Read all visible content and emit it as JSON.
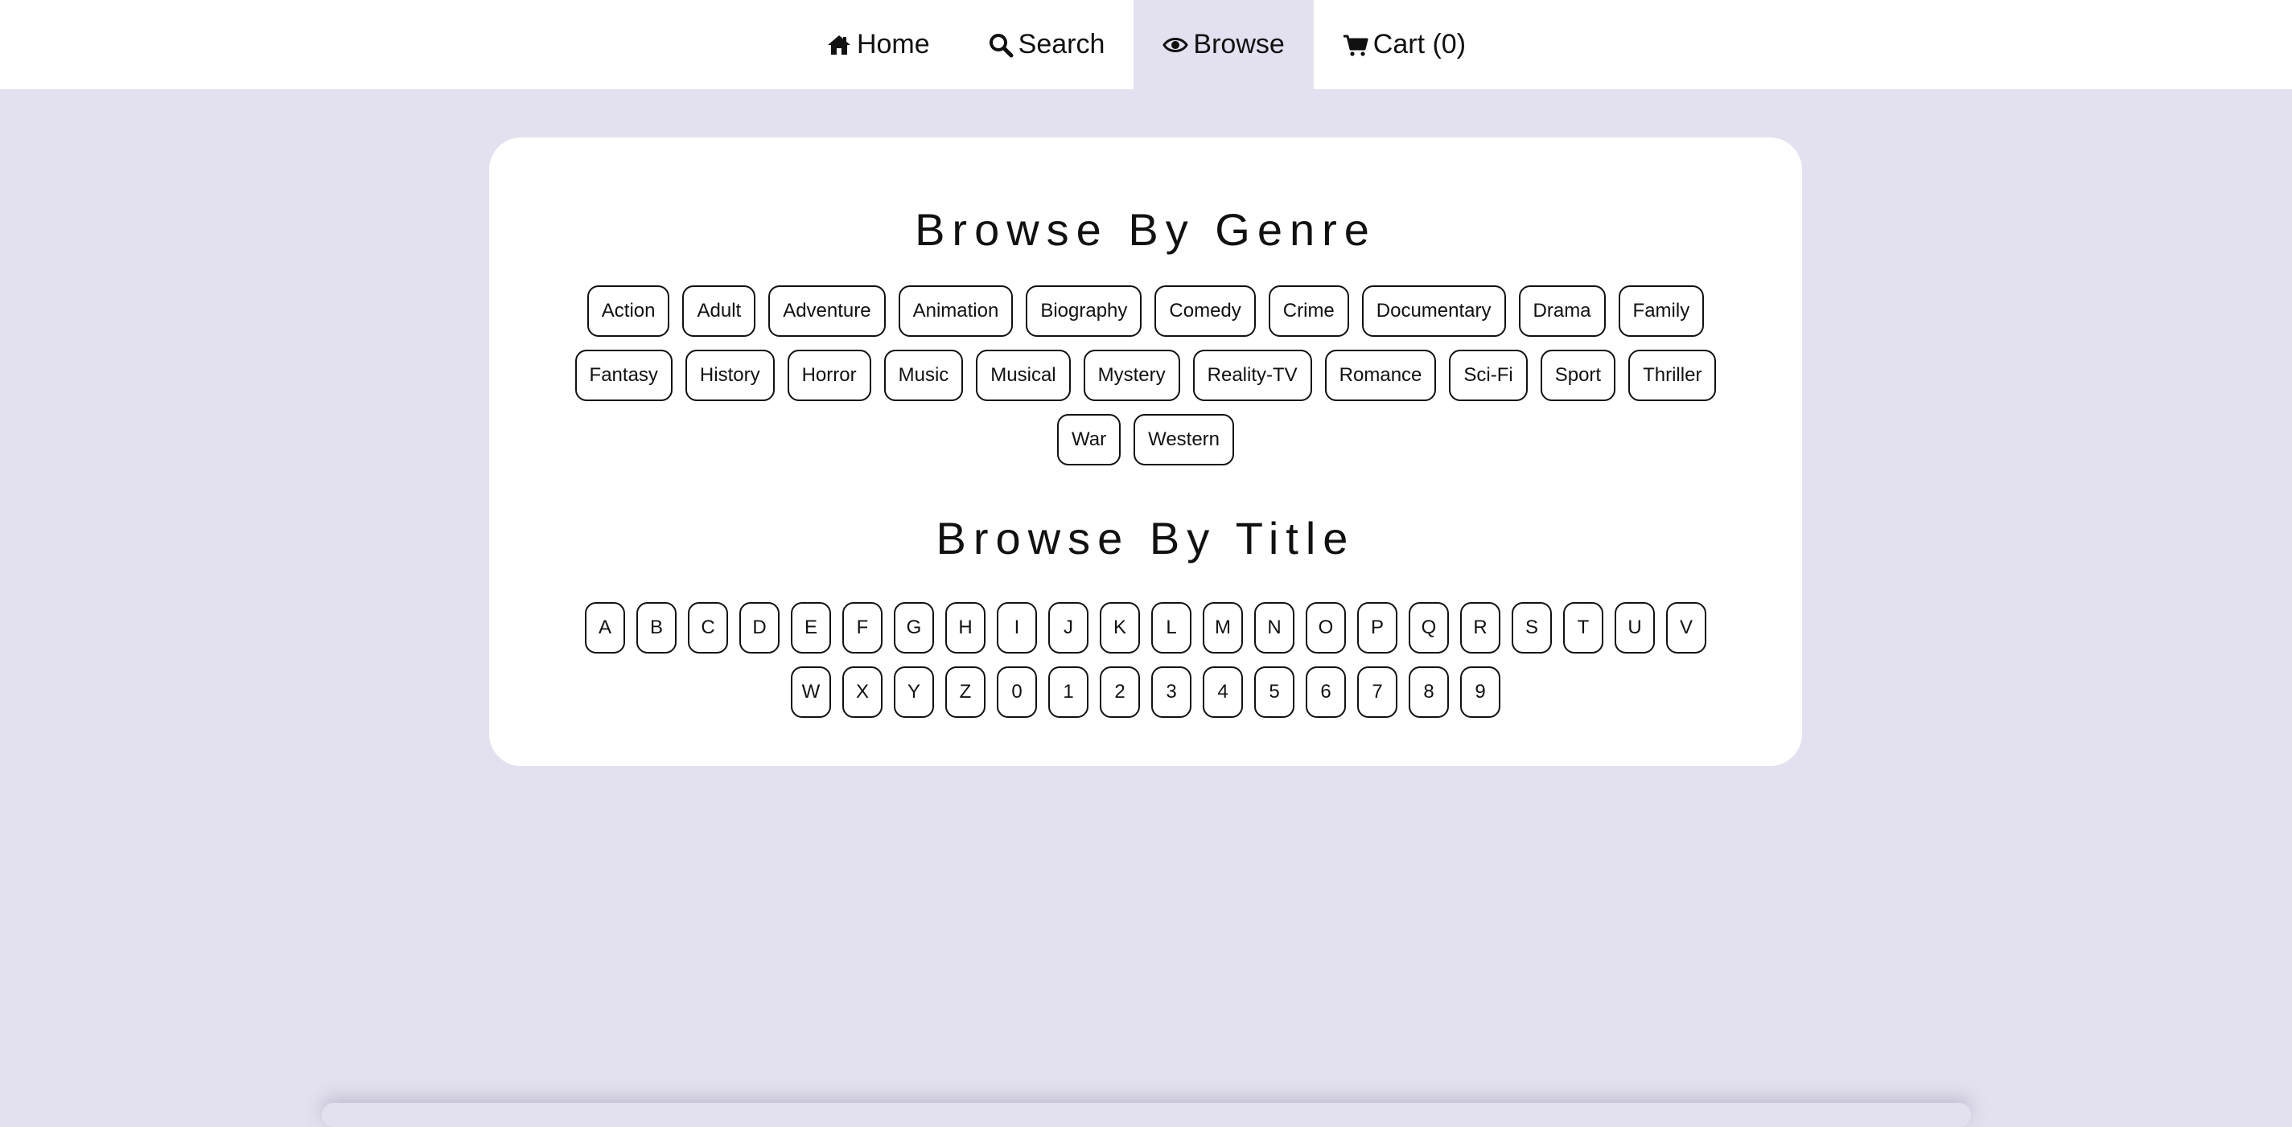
{
  "nav": {
    "items": [
      {
        "label": "Home",
        "icon": "home-icon",
        "active": false
      },
      {
        "label": "Search",
        "icon": "search-icon",
        "active": false
      },
      {
        "label": "Browse",
        "icon": "eye-icon",
        "active": true
      },
      {
        "label": "Cart (0)",
        "icon": "cart-icon",
        "active": false
      }
    ]
  },
  "colors": {
    "background": "#e3e1ef",
    "card": "#ffffff",
    "text": "#111111"
  },
  "genre_section": {
    "title": "Browse By Genre",
    "genres": [
      "Action",
      "Adult",
      "Adventure",
      "Animation",
      "Biography",
      "Comedy",
      "Crime",
      "Documentary",
      "Drama",
      "Family",
      "Fantasy",
      "History",
      "Horror",
      "Music",
      "Musical",
      "Mystery",
      "Reality-TV",
      "Romance",
      "Sci-Fi",
      "Sport",
      "Thriller",
      "War",
      "Western"
    ]
  },
  "title_section": {
    "title": "Browse By Title",
    "letters": [
      "A",
      "B",
      "C",
      "D",
      "E",
      "F",
      "G",
      "H",
      "I",
      "J",
      "K",
      "L",
      "M",
      "N",
      "O",
      "P",
      "Q",
      "R",
      "S",
      "T",
      "U",
      "V",
      "W",
      "X",
      "Y",
      "Z",
      "0",
      "1",
      "2",
      "3",
      "4",
      "5",
      "6",
      "7",
      "8",
      "9"
    ]
  }
}
